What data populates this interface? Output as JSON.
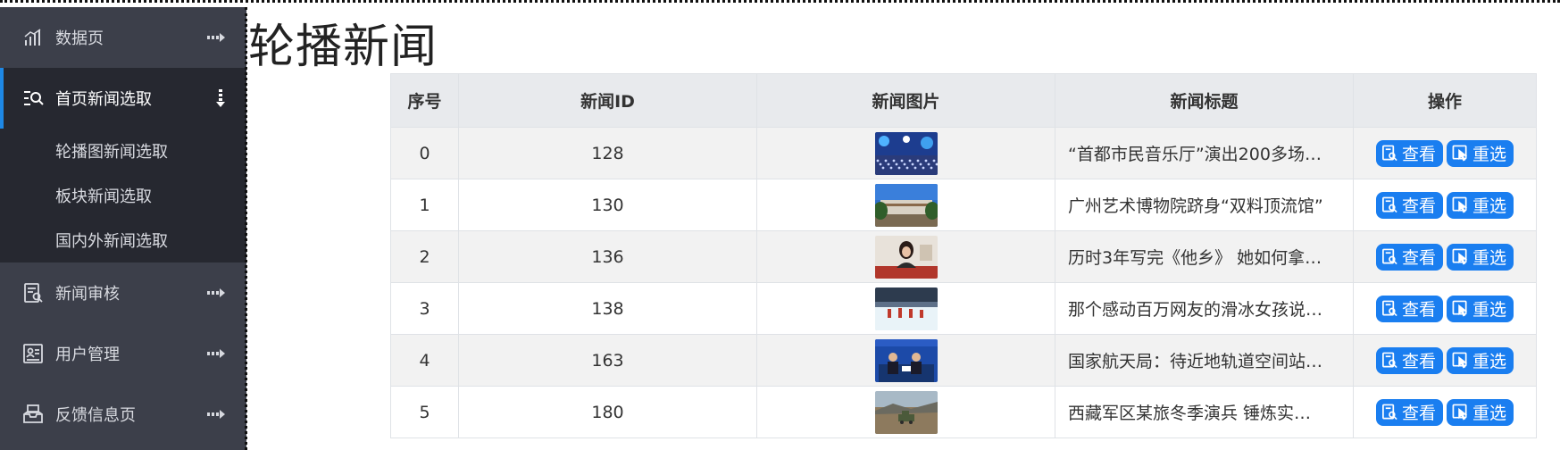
{
  "page": {
    "title": "轮播新闻"
  },
  "sidebar": {
    "items": [
      {
        "label": "数据页",
        "icon": "bar-chart-icon",
        "expanded": false,
        "active": false
      },
      {
        "label": "首页新闻选取",
        "icon": "search-list-icon",
        "expanded": true,
        "active": true
      },
      {
        "label": "新闻审核",
        "icon": "review-document-icon",
        "expanded": false,
        "active": false
      },
      {
        "label": "用户管理",
        "icon": "user-card-icon",
        "expanded": false,
        "active": false
      },
      {
        "label": "反馈信息页",
        "icon": "inbox-icon",
        "expanded": false,
        "active": false
      }
    ],
    "submenu": [
      {
        "label": "轮播图新闻选取"
      },
      {
        "label": "板块新闻选取"
      },
      {
        "label": "国内外新闻选取"
      }
    ]
  },
  "table": {
    "headers": [
      "序号",
      "新闻ID",
      "新闻图片",
      "新闻标题",
      "操作"
    ],
    "rows": [
      {
        "index": "0",
        "id": "128",
        "title": "“首都市民音乐厅”演出200多场…",
        "thumb": "concert-photo"
      },
      {
        "index": "1",
        "id": "130",
        "title": "广州艺术博物院跻身“双料顶流馆”",
        "thumb": "museum-photo"
      },
      {
        "index": "2",
        "id": "136",
        "title": "历时3年写完《他乡》 她如何拿…",
        "thumb": "portrait-photo"
      },
      {
        "index": "3",
        "id": "138",
        "title": "那个感动百万网友的滑冰女孩说…",
        "thumb": "ice-rink-photo"
      },
      {
        "index": "4",
        "id": "163",
        "title": "国家航天局：待近地轨道空间站…",
        "thumb": "press-conference-photo"
      },
      {
        "index": "5",
        "id": "180",
        "title": "西藏军区某旅冬季演兵 锤炼实…",
        "thumb": "military-vehicle-photo"
      }
    ],
    "actions": {
      "view": "查看",
      "reselect": "重选"
    }
  },
  "colors": {
    "sidebar_bg": "#3c3f4a",
    "sidebar_active_bg": "#262830",
    "accent": "#1e88e5",
    "button": "#1a7ef0"
  }
}
